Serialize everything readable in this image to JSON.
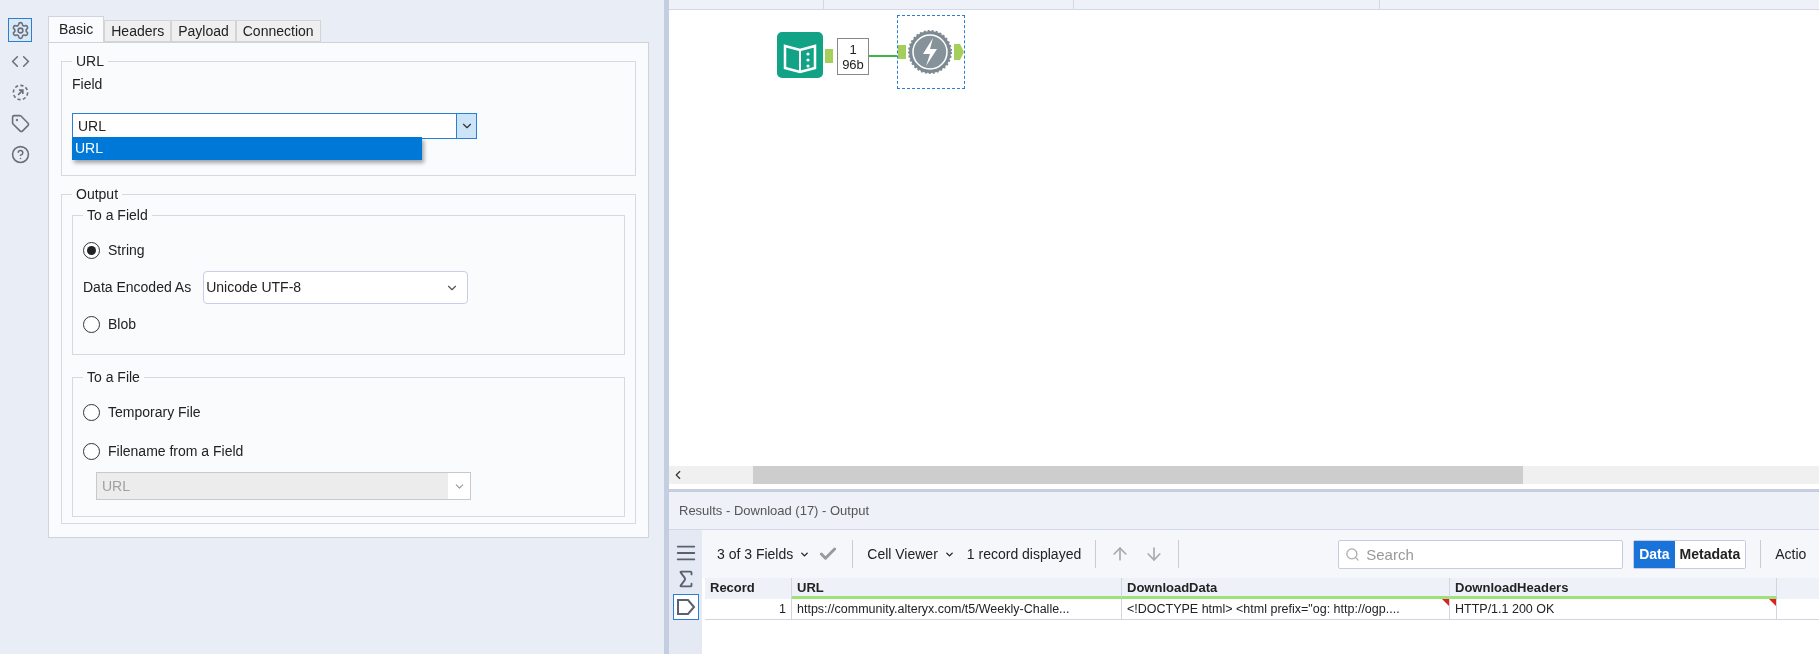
{
  "side_icons": [
    {
      "kind": "settings",
      "selected": true
    },
    {
      "kind": "code",
      "selected": false
    },
    {
      "kind": "output",
      "selected": false
    },
    {
      "kind": "tag",
      "selected": false
    },
    {
      "kind": "help",
      "selected": false
    }
  ],
  "tabs": [
    {
      "label": "Basic",
      "selected": true
    },
    {
      "label": "Headers",
      "selected": false
    },
    {
      "label": "Payload",
      "selected": false
    },
    {
      "label": "Connection",
      "selected": false
    }
  ],
  "url_group": {
    "title": "URL",
    "field_label": "Field",
    "dropdown": {
      "value": "URL",
      "expanded": true,
      "options": [
        {
          "label": "URL",
          "selected": true
        }
      ]
    }
  },
  "output_group": {
    "title": "Output",
    "to_field": {
      "title": "To a Field",
      "options": [
        {
          "label": "String",
          "selected": true
        },
        {
          "label": "Blob",
          "selected": false
        }
      ],
      "encoding_label": "Data Encoded As",
      "encoding": "Unicode UTF-8"
    },
    "to_file": {
      "title": "To a File",
      "options": [
        {
          "label": "Temporary File",
          "selected": false
        },
        {
          "label": "Filename from a Field",
          "selected": false
        }
      ],
      "field_dropdown": {
        "value": "URL",
        "disabled": true
      }
    }
  },
  "canvas": {
    "record_badge": [
      "1",
      "96b"
    ],
    "tool_selected": true
  },
  "results": {
    "title": "Results - Download (17) - Output",
    "fields": "3 of 3 Fields",
    "cell_viewer": "Cell Viewer",
    "records": "1 record displayed",
    "search": {
      "placeholder": "Search"
    },
    "views": [
      {
        "label": "Data",
        "selected": true
      },
      {
        "label": "Metadata",
        "selected": false
      }
    ],
    "actions": "Actio",
    "table": {
      "columns": [
        "Record",
        "URL",
        "DownloadData",
        "DownloadHeaders"
      ],
      "rows": [
        [
          "1",
          "https://community.alteryx.com/t5/Weekly-Challe...",
          "<!DOCTYPE html> <html prefix=\"og: http://ogp....",
          "HTTP/1.1 200 OK"
        ]
      ]
    }
  }
}
